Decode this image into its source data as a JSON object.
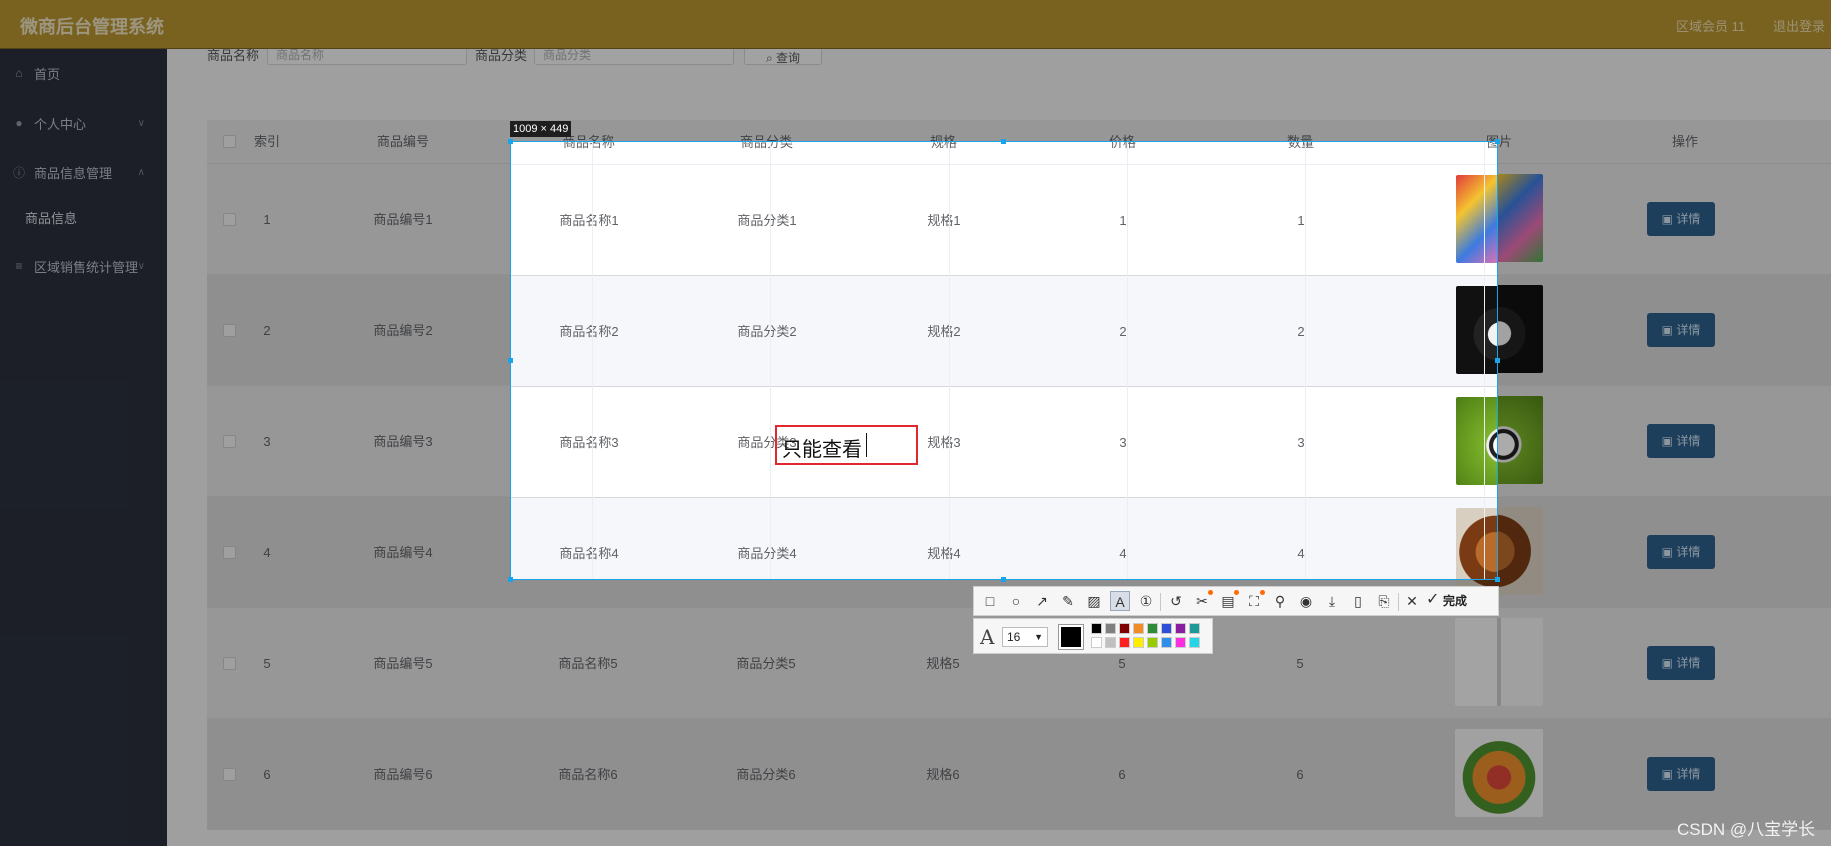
{
  "header": {
    "app_title": "微商后台管理系统",
    "user_label": "区域会员 11",
    "logout_label": "退出登录"
  },
  "sidebar": {
    "items": [
      {
        "label": "首页",
        "icon": "home-icon"
      },
      {
        "label": "个人中心",
        "icon": "user-icon"
      },
      {
        "label": "商品信息管理",
        "icon": "info-circle-icon"
      },
      {
        "label": "商品信息",
        "icon": ""
      },
      {
        "label": "区域销售统计管理",
        "icon": "list-icon"
      }
    ]
  },
  "search": {
    "name_label": "商品名称",
    "name_placeholder": "商品名称",
    "category_label": "商品分类",
    "category_placeholder": "商品分类",
    "button_label": "查询"
  },
  "table": {
    "columns": [
      "索引",
      "商品编号",
      "商品名称",
      "商品分类",
      "规格",
      "价格",
      "数量",
      "图片",
      "操作"
    ],
    "detail_label": "详情",
    "rows": [
      {
        "index": "1",
        "code": "商品编号1",
        "name": "商品名称1",
        "category": "商品分类1",
        "spec": "规格1",
        "price": "1",
        "qty": "1"
      },
      {
        "index": "2",
        "code": "商品编号2",
        "name": "商品名称2",
        "category": "商品分类2",
        "spec": "规格2",
        "price": "2",
        "qty": "2"
      },
      {
        "index": "3",
        "code": "商品编号3",
        "name": "商品名称3",
        "category": "商品分类3",
        "spec": "规格3",
        "price": "3",
        "qty": "3"
      },
      {
        "index": "4",
        "code": "商品编号4",
        "name": "商品名称4",
        "category": "商品分类4",
        "spec": "规格4",
        "price": "4",
        "qty": "4"
      },
      {
        "index": "5",
        "code": "商品编号5",
        "name": "商品名称5",
        "category": "商品分类5",
        "spec": "规格5",
        "price": "5",
        "qty": "5"
      },
      {
        "index": "6",
        "code": "商品编号6",
        "name": "商品名称6",
        "category": "商品分类6",
        "spec": "规格6",
        "price": "6",
        "qty": "6"
      }
    ]
  },
  "capture": {
    "size_label": "1009 × 449",
    "annotation_text": "只能查看",
    "font_size": "16",
    "finish_label": "完成",
    "current_color": "#000000",
    "palette": [
      "#000000",
      "#808080",
      "#800000",
      "#f28c28",
      "#2e8b3a",
      "#2f4fd8",
      "#8a1ea0",
      "#1e9a96",
      "#ffffff",
      "#c0c0c0",
      "#ff2020",
      "#ffee00",
      "#99cc00",
      "#2f8fe8",
      "#ff2de0",
      "#23d5e6"
    ],
    "tools": [
      "rectangle-icon",
      "ellipse-icon",
      "arrow-icon",
      "pencil-icon",
      "mosaic-icon",
      "text-icon",
      "number-icon",
      "undo-icon",
      "cut-icon",
      "ocr-icon",
      "fullscreen-icon",
      "pin-icon",
      "record-icon",
      "download-icon",
      "phone-icon",
      "bookmark-icon",
      "close-icon",
      "check-icon"
    ]
  },
  "watermark": "CSDN @八宝学长"
}
